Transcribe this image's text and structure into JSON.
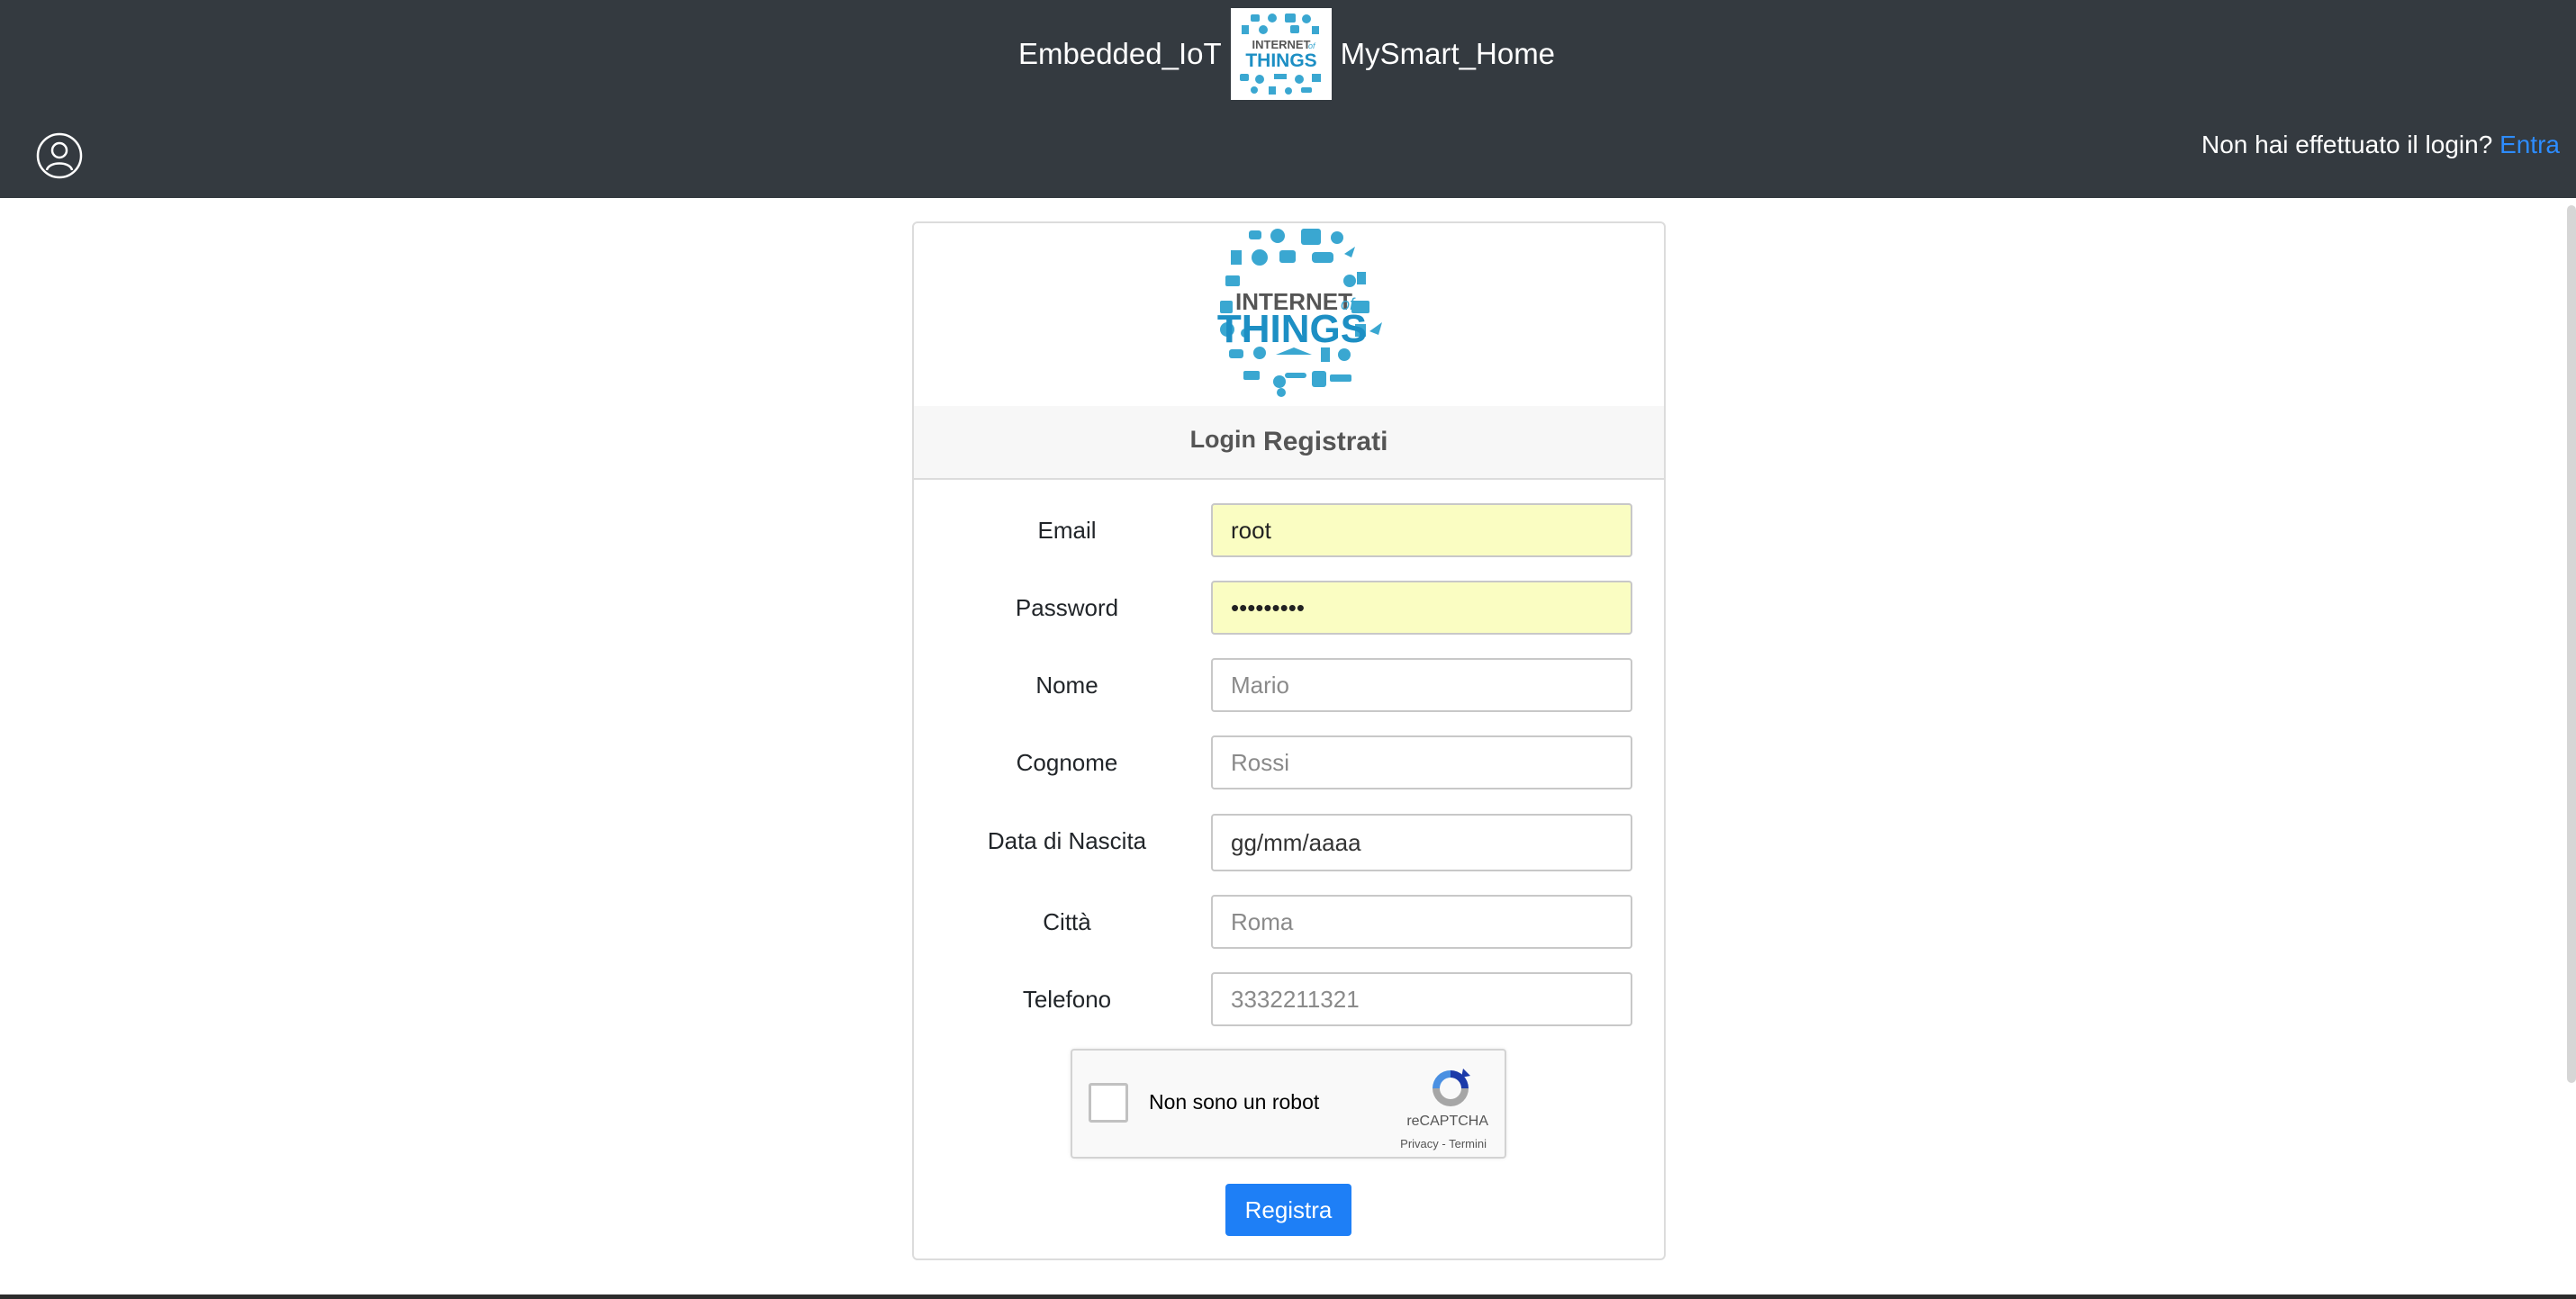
{
  "header": {
    "brand_left": "Embedded_IoT",
    "brand_right": "MySmart_Home",
    "login_prompt": "Non hai effettuato il login?",
    "login_link": "Entra",
    "logo_caption_top": "INTERNET",
    "logo_caption_of": "of",
    "logo_caption_bottom": "THINGS"
  },
  "card": {
    "tab_login": "Login",
    "tab_register": "Registrati",
    "logo_caption_top": "INTERNET",
    "logo_caption_of": "of",
    "logo_caption_bottom": "THINGS"
  },
  "form": {
    "email": {
      "label": "Email",
      "value": "root",
      "placeholder": ""
    },
    "password": {
      "label": "Password",
      "value": "123456789",
      "placeholder": ""
    },
    "nome": {
      "label": "Nome",
      "value": "",
      "placeholder": "Mario"
    },
    "cognome": {
      "label": "Cognome",
      "value": "",
      "placeholder": "Rossi"
    },
    "nascita": {
      "label": "Data di Nascita",
      "value": "",
      "placeholder": "gg/mm/aaaa"
    },
    "citta": {
      "label": "Città",
      "value": "",
      "placeholder": "Roma"
    },
    "telefono": {
      "label": "Telefono",
      "value": "",
      "placeholder": "3332211321"
    }
  },
  "captcha": {
    "label": "Non sono un robot",
    "brand": "reCAPTCHA",
    "links": "Privacy - Termini",
    "checked": false
  },
  "submit_label": "Registra",
  "colors": {
    "header_bg": "#343a40",
    "link": "#2d8cff",
    "primary_button": "#1e7ff6",
    "autofill_bg": "#fafdc2",
    "iot_blue": "#3aa7d1"
  },
  "icons": {
    "user": "user-circle-icon",
    "captcha": "recaptcha-icon"
  }
}
